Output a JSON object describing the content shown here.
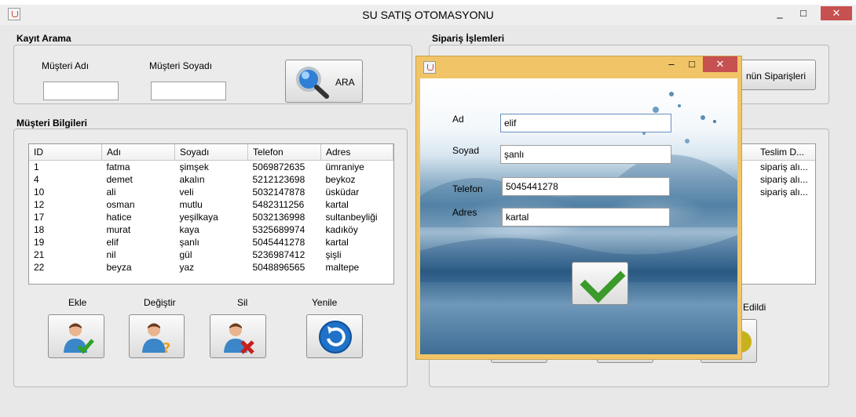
{
  "app": {
    "title": "SU SATIŞ OTOMASYONU",
    "window_controls": [
      "_",
      "□",
      "✕"
    ]
  },
  "search": {
    "section_title": "Kayıt Arama",
    "first_name_label": "Müşteri Adı",
    "last_name_label": "Müşteri Soyadı",
    "first_name_value": "",
    "last_name_value": "",
    "button_label": "ARA",
    "icon": "magnifier-icon"
  },
  "customers": {
    "section_title": "Müşteri Bilgileri",
    "columns": [
      "ID",
      "Adı",
      "Soyadı",
      "Telefon",
      "Adres"
    ],
    "rows": [
      [
        "1",
        "fatma",
        "şimşek",
        "5069872635",
        "ümraniye"
      ],
      [
        "4",
        "demet",
        "akalın",
        "5212123698",
        "beykoz"
      ],
      [
        "10",
        "ali",
        "veli",
        "5032147878",
        "üsküdar"
      ],
      [
        "12",
        "osman",
        "mutlu",
        "5482311256",
        "kartal"
      ],
      [
        "17",
        "hatice",
        "yeşilkaya",
        "5032136998",
        "sultanbeyliği"
      ],
      [
        "18",
        "murat",
        "kaya",
        "5325689974",
        "kadıköy"
      ],
      [
        "19",
        "elif",
        "şanlı",
        "5045441278",
        "kartal"
      ],
      [
        "21",
        "nil",
        "gül",
        "5236987412",
        "şişli"
      ],
      [
        "22",
        "beyza",
        "yaz",
        "5048896565",
        "maltepe"
      ]
    ],
    "actions": {
      "add_label": "Ekle",
      "edit_label": "Değiştir",
      "delete_label": "Sil",
      "refresh_label": "Yenile"
    }
  },
  "orders": {
    "section_title": "Sipariş İşlemleri",
    "customer_orders_button": "nün Siparişleri",
    "column_header": "Teslim D...",
    "rows": [
      "sipariş alı...",
      "sipariş alı...",
      "sipariş alı..."
    ],
    "delivered_label": "Edildi"
  },
  "dialog": {
    "name_label": "Ad",
    "name_value": "elif",
    "surname_label": "Soyad",
    "surname_value": "şanlı",
    "phone_label": "Telefon",
    "phone_value": "5045441278",
    "address_label": "Adres",
    "address_value": "kartal",
    "controls": [
      "–",
      "□",
      "✕"
    ]
  },
  "colors": {
    "dialog_frame": "#f1c567",
    "close_button": "#c75050",
    "confirm_check": "#3a9a2a",
    "refresh_icon": "#1f72c8"
  }
}
